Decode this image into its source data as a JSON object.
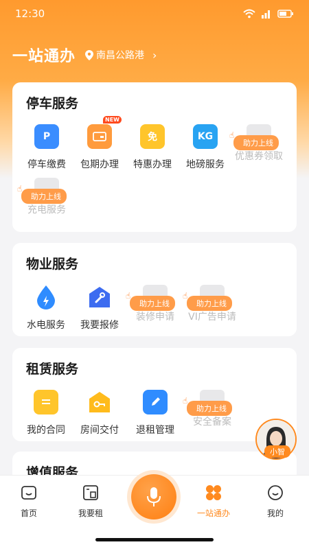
{
  "status_bar": {
    "time": "12:30"
  },
  "header": {
    "title": "一站通办",
    "location": "南昌公路港"
  },
  "boost_label": "助力上线",
  "new_badge": "NEW",
  "sections": {
    "parking": {
      "title": "停车服务",
      "items": [
        {
          "label": "停车缴费",
          "glyph": "P"
        },
        {
          "label": "包期办理",
          "glyph": ""
        },
        {
          "label": "特惠办理",
          "glyph": "免"
        },
        {
          "label": "地磅服务",
          "glyph": "KG"
        },
        {
          "label": "优惠券领取",
          "glyph": ""
        },
        {
          "label": "充电服务",
          "glyph": ""
        }
      ]
    },
    "property": {
      "title": "物业服务",
      "items": [
        {
          "label": "水电服务"
        },
        {
          "label": "我要报修"
        },
        {
          "label": "装修申请"
        },
        {
          "label": "VI广告申请"
        }
      ]
    },
    "rental": {
      "title": "租赁服务",
      "items": [
        {
          "label": "我的合同"
        },
        {
          "label": "房间交付"
        },
        {
          "label": "退租管理"
        },
        {
          "label": "安全备案"
        }
      ]
    },
    "value_added": {
      "title": "增值服务"
    }
  },
  "assistant": {
    "label": "小智"
  },
  "tabbar": {
    "home": "首页",
    "rent": "我要租",
    "services": "一站通办",
    "mine": "我的"
  },
  "colors": {
    "accent": "#ff8a1f",
    "disabled_text": "#bbbbbb"
  }
}
